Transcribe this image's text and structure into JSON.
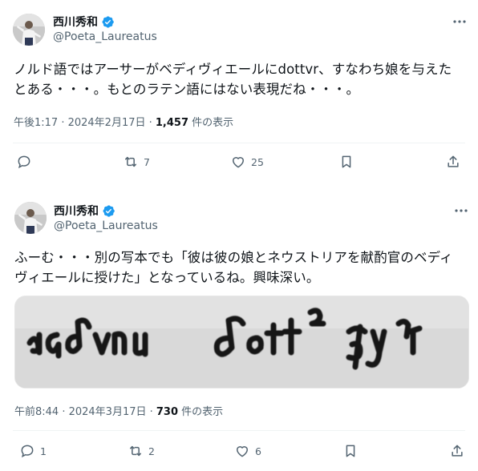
{
  "tweets": [
    {
      "author_name": "西川秀和",
      "author_handle": "@Poeta_Laureatus",
      "text_line1": "ノルド語ではアーサーがベディヴィエールにdottvr、すなわち娘を与えた",
      "text_line2": "とある・・・。もとのラテン語にはない表現だね・・・。",
      "timestamp": "午後1:17 · 2024年2月17日 · ",
      "views_count": "1,457",
      "views_label": " 件の表示",
      "reply_count": "",
      "retweet_count": "7",
      "like_count": "25"
    },
    {
      "author_name": "西川秀和",
      "author_handle": "@Poeta_Laureatus",
      "text_line1": "ふーむ・・・別の写本でも「彼は彼の娘とネウストリアを献酌官のベディ",
      "text_line2": "ヴィエールに授けた」となっているね。興味深い。",
      "timestamp": "午前8:44 · 2024年3月17日 · ",
      "views_count": "730",
      "views_label": " 件の表示",
      "reply_count": "1",
      "retweet_count": "2",
      "like_count": "6"
    }
  ],
  "icons": {
    "verified": "verified-badge-icon",
    "more": "more-dots-icon",
    "reply": "reply-icon",
    "retweet": "retweet-icon",
    "like": "heart-icon",
    "bookmark": "bookmark-icon",
    "share": "share-icon"
  },
  "colors": {
    "verified_blue": "#1d9bf0",
    "secondary_text": "#536471",
    "primary_text": "#0f1419",
    "divider": "#eff3f4"
  }
}
